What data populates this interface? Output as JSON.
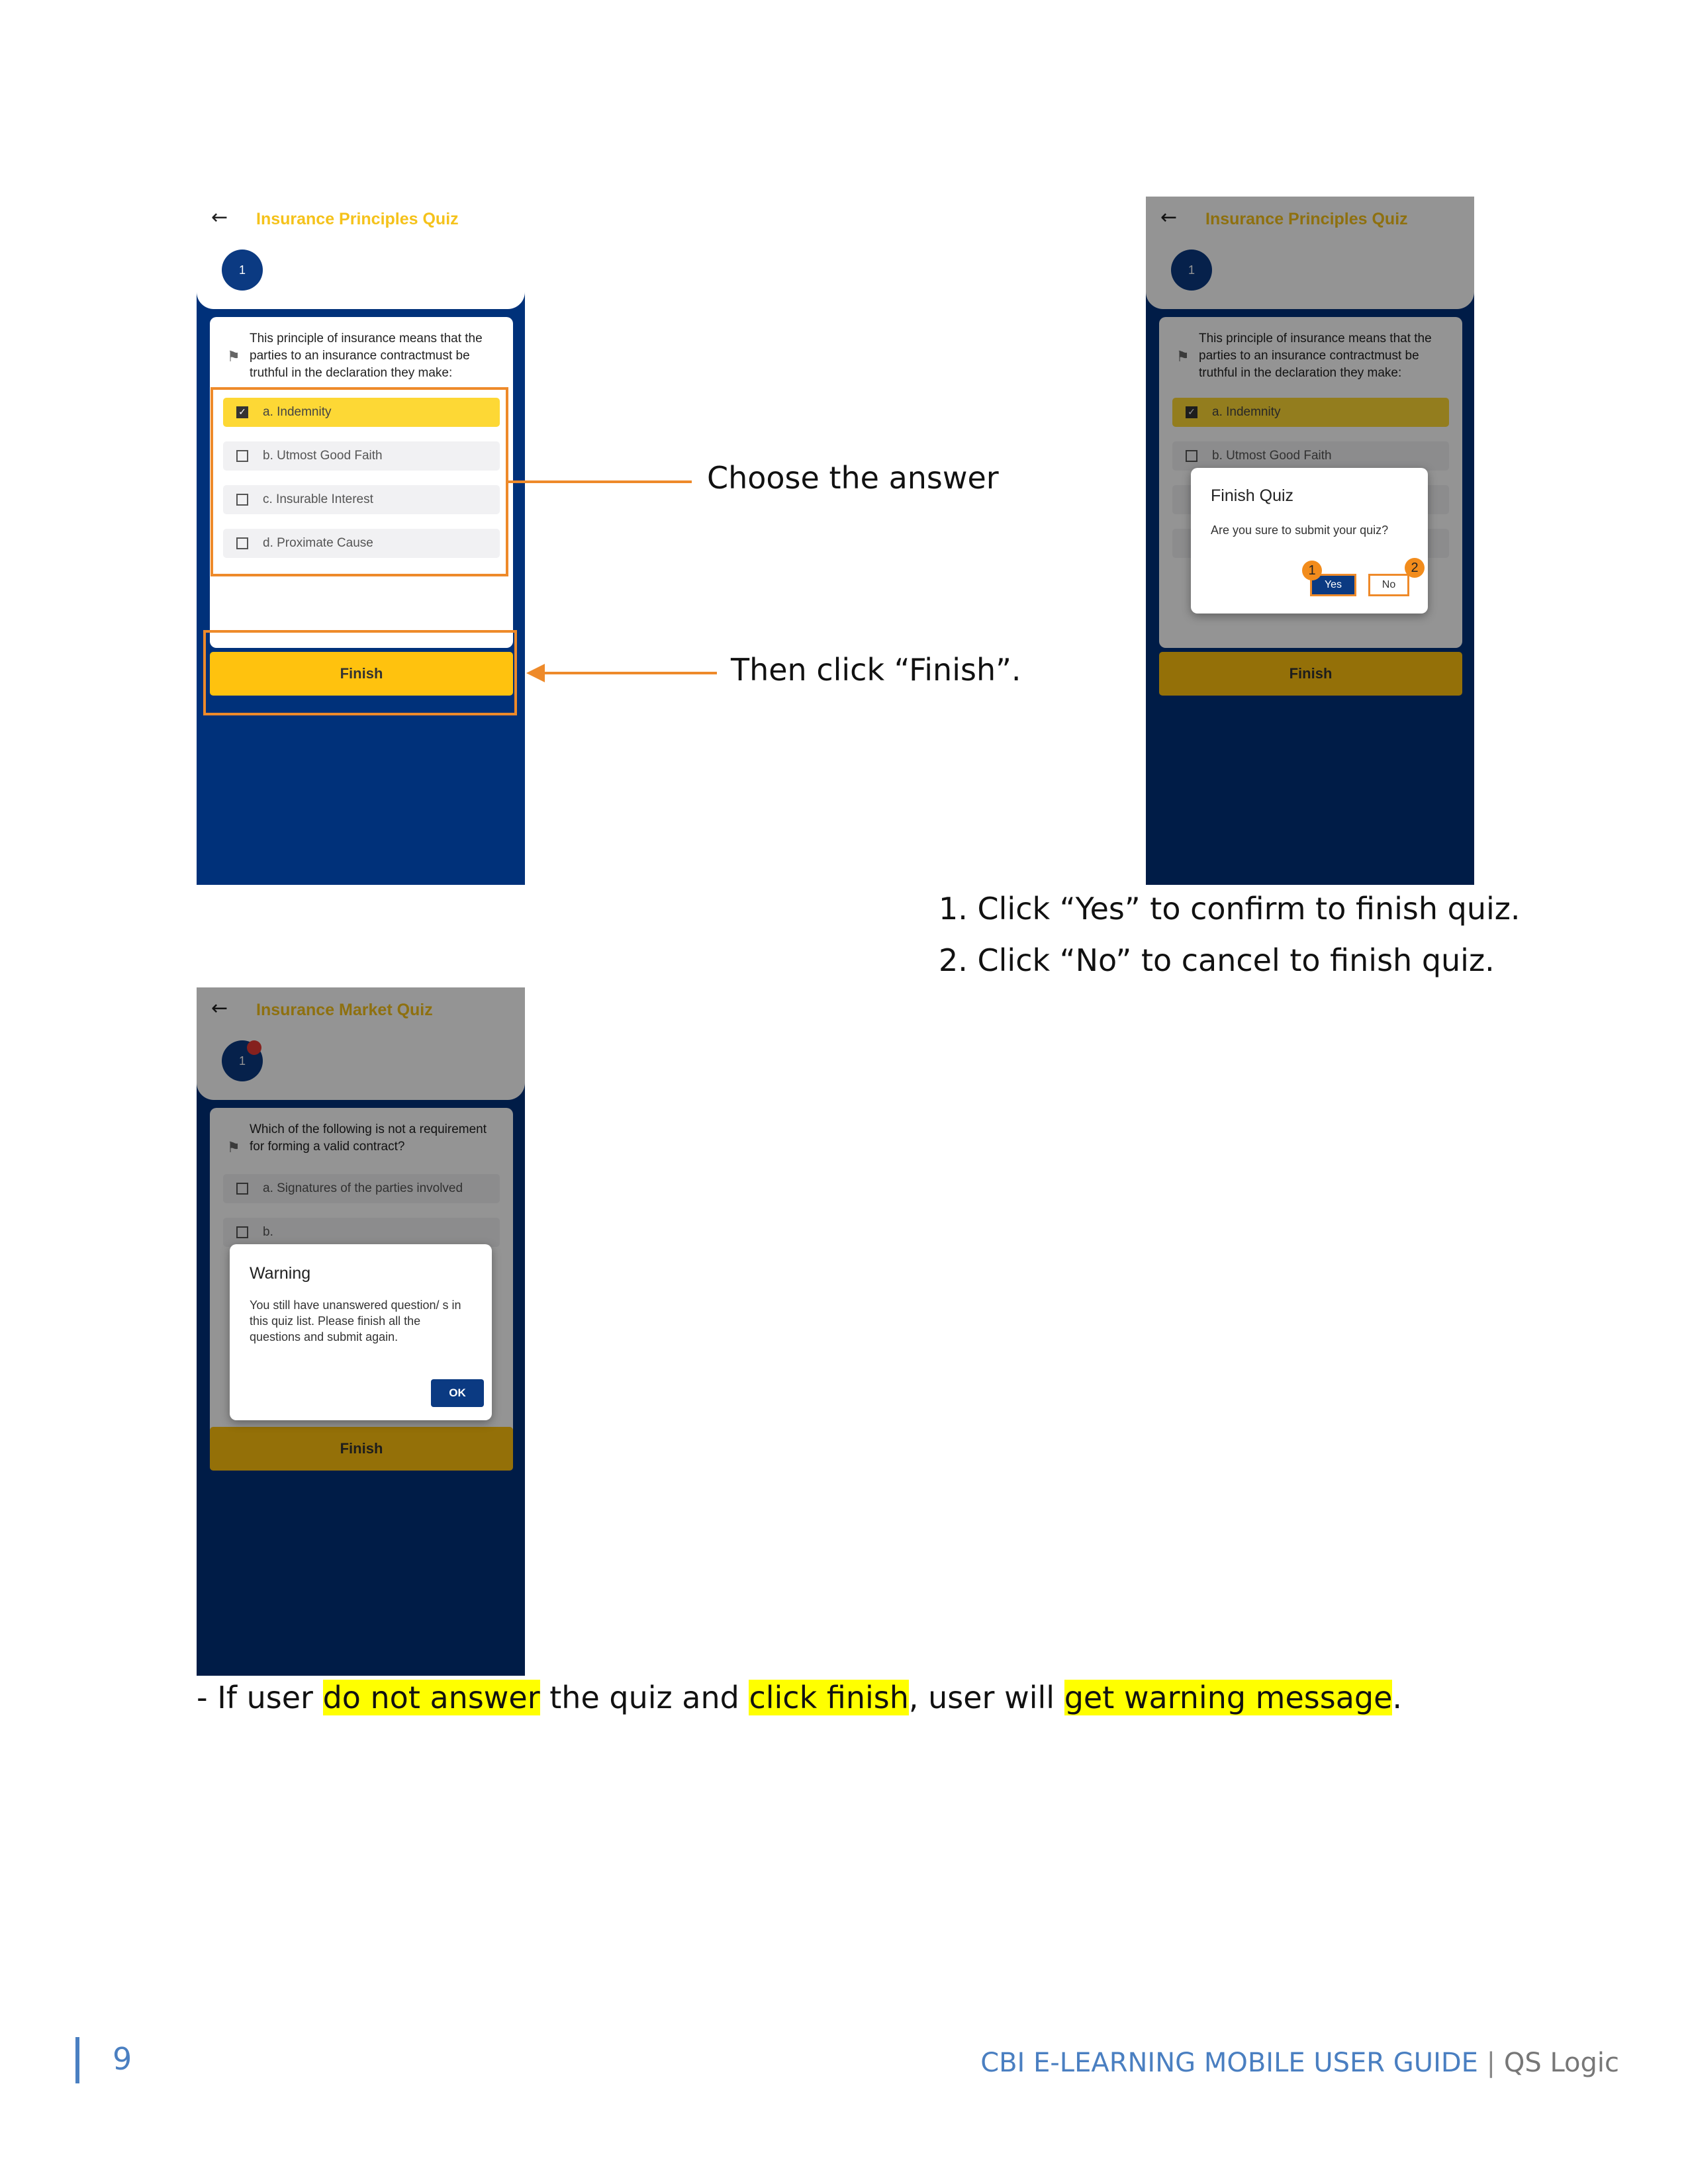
{
  "screen1": {
    "title": "Insurance Principles Quiz",
    "bubble": "1",
    "question": "This principle of insurance means that the parties to an insurance contractmust be truthful in the declaration they make:",
    "options": [
      "a. Indemnity",
      "b. Utmost Good Faith",
      "c. Insurable Interest",
      "d. Proximate Cause"
    ],
    "finish": "Finish"
  },
  "screen2": {
    "title": "Insurance Principles Quiz",
    "bubble": "1",
    "question": "This principle of insurance means that the parties to an insurance contractmust be truthful in the declaration they make:",
    "options": [
      "a. Indemnity",
      "b. Utmost Good Faith"
    ],
    "finish": "Finish",
    "dialog": {
      "title": "Finish Quiz",
      "message": "Are you sure to submit your quiz?",
      "yes": "Yes",
      "no": "No",
      "badge_yes": "1",
      "badge_no": "2"
    }
  },
  "screen3": {
    "title": "Insurance Market Quiz",
    "bubble": "1",
    "question": "Which of the following is not a requirement for forming a valid contract?",
    "options": [
      "a. Signatures of the parties involved",
      "b."
    ],
    "finish": "Finish",
    "dialog": {
      "title": "Warning",
      "message": "You still have unanswered question/ s in this quiz list. Please finish all the questions and submit again.",
      "ok": "OK"
    }
  },
  "annotations": {
    "choose": "Choose the answer",
    "then_click": "Then click “Finish”."
  },
  "steps": [
    "1. Click “Yes” to confirm to finish quiz.",
    "2. Click “No” to cancel to finish quiz."
  ],
  "note": {
    "prefix": "- If user ",
    "hl1": "do not answer",
    "mid1": " the quiz and ",
    "hl2": "click finish",
    "mid2": ", user will ",
    "hl3": "get warning message",
    "suffix": "."
  },
  "footer": {
    "page": "9",
    "brand": "CBI E-LEARNING MOBILE USER GUIDE",
    "separator": " | ",
    "section": "QS Logic"
  },
  "colors": {
    "accent_yellow": "#ffc20e",
    "title_yellow": "#f5c21b",
    "navy": "#00317a",
    "annotation_orange": "#ee8a2a",
    "highlight": "#ffff00",
    "footer_blue": "#4a7fc1"
  }
}
